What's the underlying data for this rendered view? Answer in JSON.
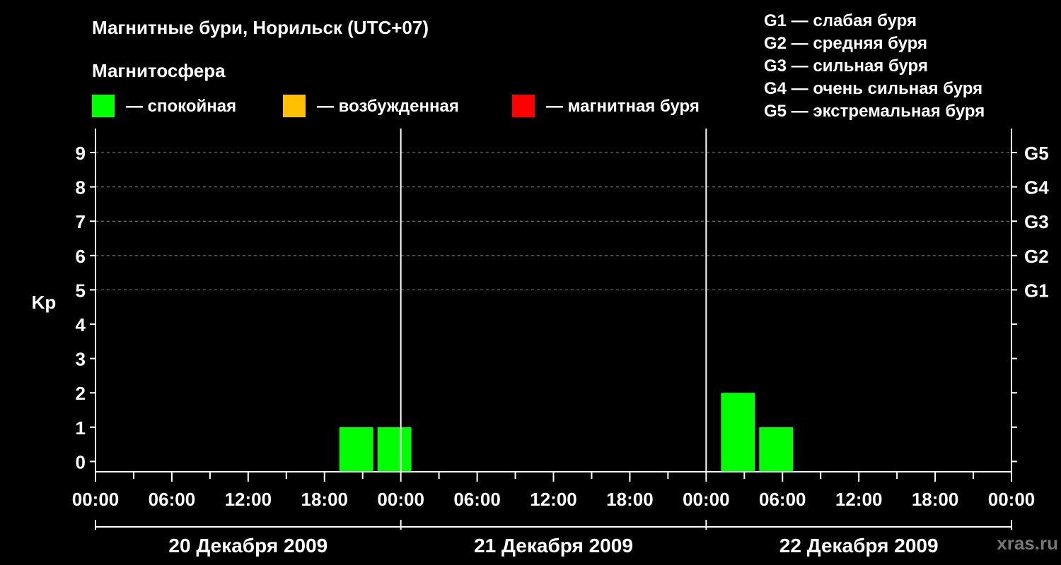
{
  "header": {
    "title": "Магнитные бури, Норильск (UTC+07)",
    "subtitle": "Магнитосфера"
  },
  "legend": [
    {
      "label": "— спокойная",
      "color": "#00ff00"
    },
    {
      "label": "— возбужденная",
      "color": "#ffc000"
    },
    {
      "label": "— магнитная буря",
      "color": "#ff0000"
    }
  ],
  "g_scale": [
    "G1 — слабая буря",
    "G2 — средняя буря",
    "G3 — сильная буря",
    "G4 — очень сильная буря",
    "G5 — экстремальная буря"
  ],
  "watermark": "xras.ru",
  "chart_data": {
    "type": "bar",
    "ylabel": "Kp",
    "ylim": [
      -0.3,
      9.7
    ],
    "yticks": [
      0,
      1,
      2,
      3,
      4,
      5,
      6,
      7,
      8,
      9
    ],
    "right_ticks": [
      {
        "kp": 5,
        "label": "G1"
      },
      {
        "kp": 6,
        "label": "G2"
      },
      {
        "kp": 7,
        "label": "G3"
      },
      {
        "kp": 8,
        "label": "G4"
      },
      {
        "kp": 9,
        "label": "G5"
      }
    ],
    "grid": "dashed at Kp 5–9",
    "x_range_hours": [
      0,
      72
    ],
    "x_tick_labels": [
      "00:00",
      "06:00",
      "12:00",
      "18:00",
      "00:00",
      "06:00",
      "12:00",
      "18:00",
      "00:00",
      "06:00",
      "12:00",
      "18:00",
      "00:00"
    ],
    "days": [
      "20 Декабря 2009",
      "21 Декабря 2009",
      "22 Декабря 2009"
    ],
    "series": [
      {
        "bars": [
          {
            "start": "2009-12-20 19:00",
            "end": "2009-12-20 22:00",
            "kp": 1,
            "color": "#00ff00"
          },
          {
            "start": "2009-12-20 22:00",
            "end": "2009-12-21 01:00",
            "kp": 1,
            "color": "#00ff00"
          },
          {
            "start": "2009-12-22 01:00",
            "end": "2009-12-22 04:00",
            "kp": 2,
            "color": "#00ff00"
          },
          {
            "start": "2009-12-22 04:00",
            "end": "2009-12-22 07:00",
            "kp": 1,
            "color": "#00ff00"
          }
        ]
      }
    ]
  }
}
